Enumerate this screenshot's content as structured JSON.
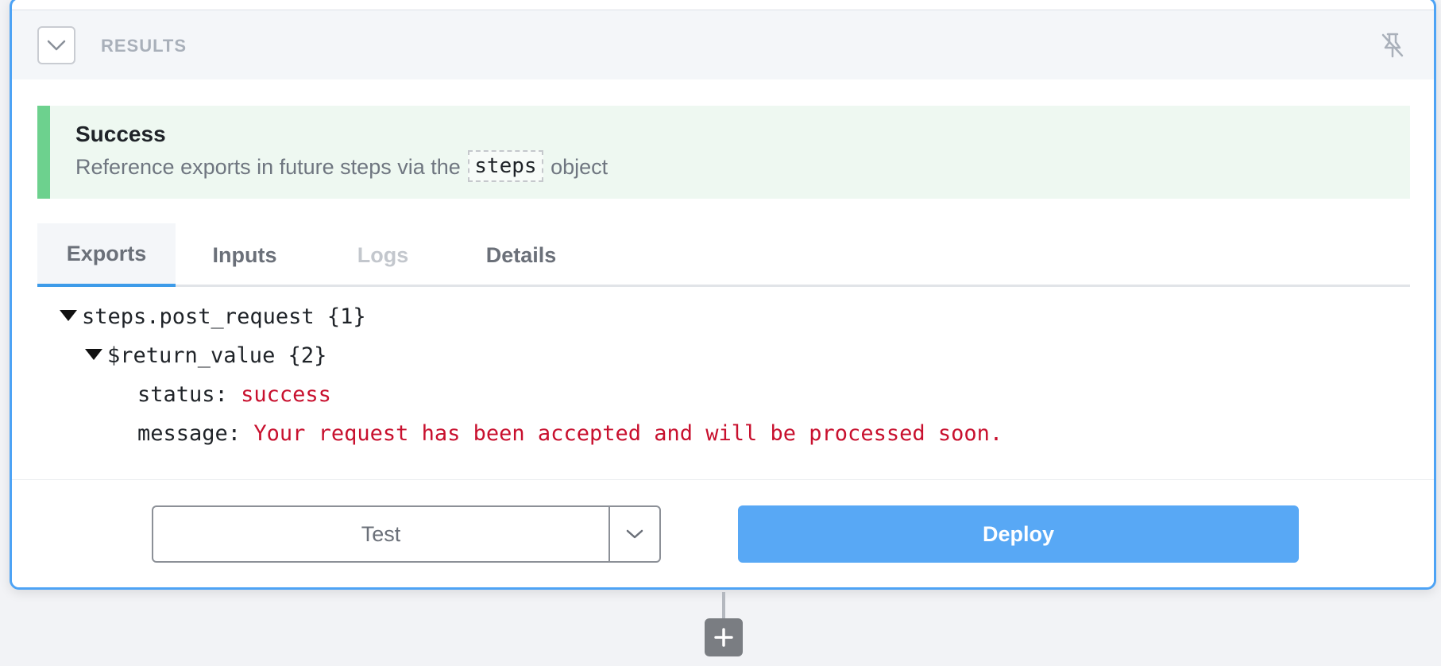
{
  "results_header": {
    "title": "RESULTS",
    "collapse_icon": "chevron-down-icon",
    "pin_icon": "unpin-icon"
  },
  "alert": {
    "title": "Success",
    "message_before": "Reference exports in future steps via the",
    "code": "steps",
    "message_after": "object",
    "accent_color": "#6dd18e"
  },
  "tabs": [
    {
      "label": "Exports",
      "state": "active"
    },
    {
      "label": "Inputs",
      "state": "normal"
    },
    {
      "label": "Logs",
      "state": "disabled"
    },
    {
      "label": "Details",
      "state": "normal"
    }
  ],
  "tree": {
    "root": "steps.post_request {1}",
    "child": "$return_value {2}",
    "fields": [
      {
        "key": "status:",
        "value": "success"
      },
      {
        "key": "message:",
        "value": "Your request has been accepted and will be processed soon."
      }
    ]
  },
  "footer": {
    "test_label": "Test",
    "deploy_label": "Deploy",
    "accent_color": "#58a8f5"
  },
  "add_step": {
    "icon": "plus-icon"
  }
}
